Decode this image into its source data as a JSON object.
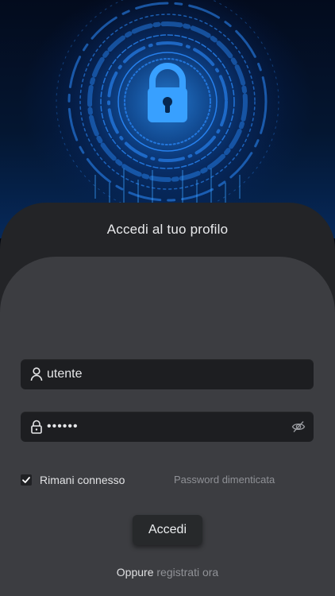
{
  "hero": {
    "image": "cyber-security-lock",
    "accent": "#1e88ff"
  },
  "login": {
    "title": "Accedi al tuo profilo",
    "username_value": "utente",
    "password_value": "••••••",
    "username_icon": "user-icon",
    "password_icon": "lock-icon",
    "visibility_icon": "eye-off-icon",
    "remember_label": "Rimani connesso",
    "remember_checked": true,
    "forgot_label": "Password dimenticata",
    "submit_label": "Accedi",
    "alt_prefix": "Oppure",
    "register_label": "registrati ora"
  },
  "colors": {
    "sheet": "#232427",
    "card": "#3c3d41",
    "field": "#1d1e21",
    "text": "#e6e7e9",
    "muted": "#8f9196"
  }
}
